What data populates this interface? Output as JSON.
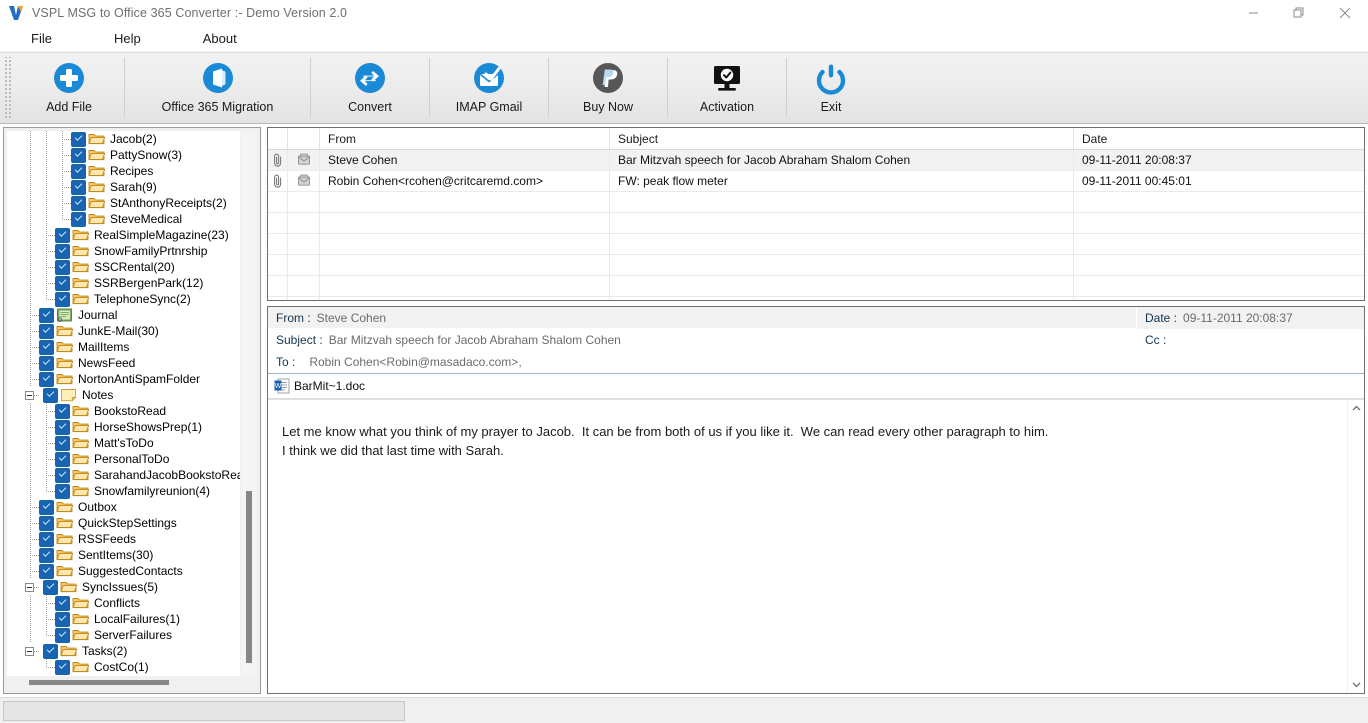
{
  "window": {
    "title": "VSPL MSG to Office 365 Converter  :- Demo Version 2.0",
    "logo_letter": "V",
    "minimize_label": "Minimize",
    "maximize_label": "Restore",
    "close_label": "Close"
  },
  "menubar": {
    "items": [
      {
        "label": "File",
        "name": "menu-file"
      },
      {
        "label": "Help",
        "name": "menu-help"
      },
      {
        "label": "About",
        "name": "menu-about"
      }
    ]
  },
  "toolbar": {
    "buttons": [
      {
        "label": "Add File",
        "icon": "plus-circle-icon",
        "color": "#1b8ad6"
      },
      {
        "label": "Office 365 Migration",
        "icon": "office365-icon",
        "color": "#1b8ad6"
      },
      {
        "label": "Convert",
        "icon": "convert-arrows-icon",
        "color": "#1b8ad6"
      },
      {
        "label": "IMAP Gmail",
        "icon": "envelope-check-icon",
        "color": "#1b8ad6"
      },
      {
        "label": "Buy Now",
        "icon": "paypal-icon",
        "color": "#575757"
      },
      {
        "label": "Activation",
        "icon": "monitor-check-icon",
        "color": "#111111"
      },
      {
        "label": "Exit",
        "icon": "power-icon",
        "color": "#1b8ad6"
      }
    ]
  },
  "tree": {
    "checkbox_color": "#1765b0",
    "nodes": [
      {
        "label": "Jacob(2)",
        "depth": 4,
        "icon": "folder-open-icon",
        "checked": true,
        "expander": "none",
        "last": false
      },
      {
        "label": "PattySnow(3)",
        "depth": 4,
        "icon": "folder-open-icon",
        "checked": true,
        "expander": "none",
        "last": false
      },
      {
        "label": "Recipes",
        "depth": 4,
        "icon": "folder-open-icon",
        "checked": true,
        "expander": "none",
        "last": false
      },
      {
        "label": "Sarah(9)",
        "depth": 4,
        "icon": "folder-open-icon",
        "checked": true,
        "expander": "none",
        "last": false
      },
      {
        "label": "StAnthonyReceipts(2)",
        "depth": 4,
        "icon": "folder-open-icon",
        "checked": true,
        "expander": "none",
        "last": false
      },
      {
        "label": "SteveMedical",
        "depth": 4,
        "icon": "folder-open-icon",
        "checked": true,
        "expander": "none",
        "last": true
      },
      {
        "label": "RealSimpleMagazine(23)",
        "depth": 3,
        "icon": "folder-open-icon",
        "checked": true,
        "expander": "none",
        "last": false
      },
      {
        "label": "SnowFamilyPrtnrship",
        "depth": 3,
        "icon": "folder-open-icon",
        "checked": true,
        "expander": "none",
        "last": false
      },
      {
        "label": "SSCRental(20)",
        "depth": 3,
        "icon": "folder-open-icon",
        "checked": true,
        "expander": "none",
        "last": false
      },
      {
        "label": "SSRBergenPark(12)",
        "depth": 3,
        "icon": "folder-open-icon",
        "checked": true,
        "expander": "none",
        "last": false
      },
      {
        "label": "TelephoneSync(2)",
        "depth": 3,
        "icon": "folder-open-icon",
        "checked": true,
        "expander": "none",
        "last": true
      },
      {
        "label": "Journal",
        "depth": 2,
        "icon": "journal-icon",
        "checked": true,
        "expander": "none",
        "last": false
      },
      {
        "label": "JunkE-Mail(30)",
        "depth": 2,
        "icon": "folder-open-icon",
        "checked": true,
        "expander": "none",
        "last": false
      },
      {
        "label": "MailItems",
        "depth": 2,
        "icon": "folder-open-icon",
        "checked": true,
        "expander": "none",
        "last": false
      },
      {
        "label": "NewsFeed",
        "depth": 2,
        "icon": "folder-open-icon",
        "checked": true,
        "expander": "none",
        "last": false
      },
      {
        "label": "NortonAntiSpamFolder",
        "depth": 2,
        "icon": "folder-open-icon",
        "checked": true,
        "expander": "none",
        "last": false
      },
      {
        "label": "Notes",
        "depth": 2,
        "icon": "note-icon",
        "checked": true,
        "expander": "minus",
        "last": false
      },
      {
        "label": "BookstoRead",
        "depth": 3,
        "icon": "folder-open-icon",
        "checked": true,
        "expander": "none",
        "last": false
      },
      {
        "label": "HorseShowsPrep(1)",
        "depth": 3,
        "icon": "folder-open-icon",
        "checked": true,
        "expander": "none",
        "last": false
      },
      {
        "label": "Matt'sToDo",
        "depth": 3,
        "icon": "folder-open-icon",
        "checked": true,
        "expander": "none",
        "last": false
      },
      {
        "label": "PersonalToDo",
        "depth": 3,
        "icon": "folder-open-icon",
        "checked": true,
        "expander": "none",
        "last": false
      },
      {
        "label": "SarahandJacobBookstoRead",
        "depth": 3,
        "icon": "folder-open-icon",
        "checked": true,
        "expander": "none",
        "last": false
      },
      {
        "label": "Snowfamilyreunion(4)",
        "depth": 3,
        "icon": "folder-open-icon",
        "checked": true,
        "expander": "none",
        "last": true
      },
      {
        "label": "Outbox",
        "depth": 2,
        "icon": "folder-open-icon",
        "checked": true,
        "expander": "none",
        "last": false
      },
      {
        "label": "QuickStepSettings",
        "depth": 2,
        "icon": "folder-open-icon",
        "checked": true,
        "expander": "none",
        "last": false
      },
      {
        "label": "RSSFeeds",
        "depth": 2,
        "icon": "folder-open-icon",
        "checked": true,
        "expander": "none",
        "last": false
      },
      {
        "label": "SentItems(30)",
        "depth": 2,
        "icon": "folder-open-icon",
        "checked": true,
        "expander": "none",
        "last": false
      },
      {
        "label": "SuggestedContacts",
        "depth": 2,
        "icon": "folder-open-icon",
        "checked": true,
        "expander": "none",
        "last": false
      },
      {
        "label": "SyncIssues(5)",
        "depth": 2,
        "icon": "folder-open-icon",
        "checked": true,
        "expander": "minus",
        "last": false
      },
      {
        "label": "Conflicts",
        "depth": 3,
        "icon": "folder-open-icon",
        "checked": true,
        "expander": "none",
        "last": false
      },
      {
        "label": "LocalFailures(1)",
        "depth": 3,
        "icon": "folder-open-icon",
        "checked": true,
        "expander": "none",
        "last": false
      },
      {
        "label": "ServerFailures",
        "depth": 3,
        "icon": "folder-open-icon",
        "checked": true,
        "expander": "none",
        "last": true
      },
      {
        "label": "Tasks(2)",
        "depth": 2,
        "icon": "folder-open-icon",
        "checked": true,
        "expander": "minus",
        "last": false
      },
      {
        "label": "CostCo(1)",
        "depth": 3,
        "icon": "folder-open-icon",
        "checked": true,
        "expander": "none",
        "last": true
      }
    ]
  },
  "message_grid": {
    "columns": [
      "",
      "",
      "From",
      "Subject",
      "Date"
    ],
    "rows": [
      {
        "attachment": "paperclip-icon",
        "flag": "mail-icon",
        "from": "Steve Cohen",
        "subject": "Bar Mitzvah speech for Jacob Abraham Shalom Cohen",
        "date": "09-11-2011 20:08:37",
        "selected": true
      },
      {
        "attachment": "paperclip-icon",
        "flag": "mail-icon",
        "from": "Robin Cohen<rcohen@critcaremd.com>",
        "subject": "FW: peak flow meter",
        "date": "09-11-2011 00:45:01",
        "selected": false
      }
    ],
    "empty_row_count": 6
  },
  "detail": {
    "from_label": "From :",
    "from_value": "Steve Cohen",
    "subject_label": "Subject :",
    "subject_value": "Bar Mitzvah speech for Jacob Abraham Shalom Cohen",
    "to_label": "To :",
    "to_value": "Robin Cohen<Robin@masadaco.com>,",
    "date_label": "Date :",
    "date_value": "09-11-2011 20:08:37",
    "cc_label": "Cc :",
    "cc_value": "",
    "attachment_name": "BarMit~1.doc",
    "attachment_icon": "word-doc-icon",
    "body": "Let me know what you think of my prayer to Jacob.  It can be from both of us if you like it.  We can read every other paragraph to him.\nI think we did that last time with Sarah."
  },
  "statusbar": {
    "text": ""
  }
}
